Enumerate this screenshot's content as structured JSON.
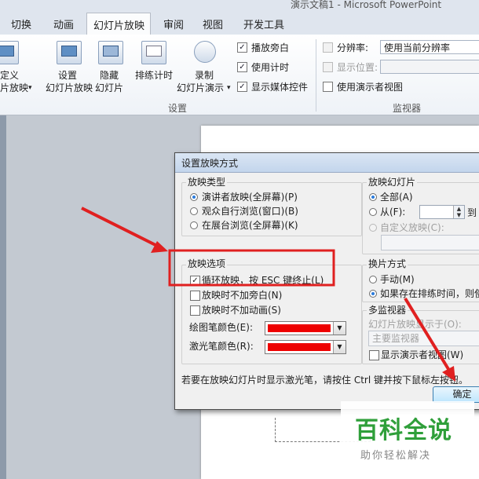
{
  "window": {
    "title": "演示文稿1 - Microsoft PowerPoint"
  },
  "ribbon_tabs": [
    "切换",
    "动画",
    "幻灯片放映",
    "审阅",
    "视图",
    "开发工具"
  ],
  "active_tab": "幻灯片放映",
  "ribbon": {
    "custom_show": {
      "line1": "定义",
      "line2": "片放映"
    },
    "setup_show": {
      "line1": "设置",
      "line2": "幻灯片放映"
    },
    "hide_slide": {
      "line1": "隐藏",
      "line2": "幻灯片"
    },
    "rehearse": {
      "label": "排练计时"
    },
    "record": {
      "line1": "录制",
      "line2": "幻灯片演示"
    },
    "checks": {
      "play_narration": {
        "label": "播放旁白",
        "checked": true
      },
      "use_timings": {
        "label": "使用计时",
        "checked": true
      },
      "show_media_controls": {
        "label": "显示媒体控件",
        "checked": true
      }
    },
    "group_setup_label": "设置",
    "monitors": {
      "resolution_label": "分辨率:",
      "resolution_value": "使用当前分辨率",
      "show_on_label": "显示位置:",
      "presenter_view_label": "使用演示者视图",
      "group_label": "监视器"
    }
  },
  "dialog": {
    "title": "设置放映方式",
    "show_type": {
      "title": "放映类型",
      "options": [
        "演讲者放映(全屏幕)(P)",
        "观众自行浏览(窗口)(B)",
        "在展台浏览(全屏幕)(K)"
      ],
      "selected": 0
    },
    "show_options": {
      "title": "放映选项",
      "loop": {
        "label": "循环放映，按 ESC 键终止(L)",
        "checked": true
      },
      "no_narration": {
        "label": "放映时不加旁白(N)",
        "checked": false
      },
      "no_animation": {
        "label": "放映时不加动画(S)",
        "checked": false
      },
      "pen_color_label": "绘图笔颜色(E):",
      "laser_color_label": "激光笔颜色(R):",
      "pen_color": "#ee0000",
      "laser_color": "#ee0000"
    },
    "show_slides": {
      "title": "放映幻灯片",
      "all": "全部(A)",
      "from": "从(F):",
      "to": "到",
      "custom": "自定义放映(C):"
    },
    "advance": {
      "title": "换片方式",
      "manual": "手动(M)",
      "timings": "如果存在排练时间，则使"
    },
    "multi_monitor": {
      "title": "多监视器",
      "display_on_label": "幻灯片放映显示于(O):",
      "display_value": "主要监视器",
      "presenter_view": "显示演示者视图(W)"
    },
    "hint": "若要在放映幻灯片时显示激光笔，请按住 Ctrl 键并按下鼠标左按钮。",
    "ok": "确定"
  },
  "watermark": {
    "big": "百科全说",
    "small": "助你轻松解决"
  },
  "colors": {
    "annotation_red": "#e02020",
    "watermark_green": "#2f9f3a"
  }
}
